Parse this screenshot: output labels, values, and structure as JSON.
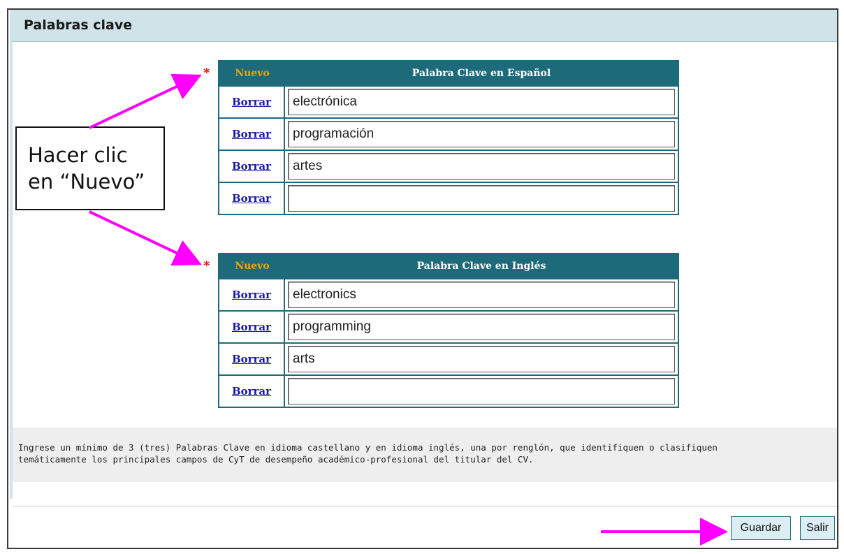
{
  "panel": {
    "title": "Palabras clave"
  },
  "tables": {
    "es": {
      "new_label": "Nuevo",
      "header": "Palabra Clave en Español",
      "rows": [
        {
          "delete_label": "Borrar",
          "value": "electrónica"
        },
        {
          "delete_label": "Borrar",
          "value": "programación"
        },
        {
          "delete_label": "Borrar",
          "value": "artes"
        },
        {
          "delete_label": "Borrar",
          "value": ""
        }
      ]
    },
    "en": {
      "new_label": "Nuevo",
      "header": "Palabra Clave en Inglés",
      "rows": [
        {
          "delete_label": "Borrar",
          "value": "electronics"
        },
        {
          "delete_label": "Borrar",
          "value": "programming"
        },
        {
          "delete_label": "Borrar",
          "value": "arts"
        },
        {
          "delete_label": "Borrar",
          "value": ""
        }
      ]
    }
  },
  "required_marker": "*",
  "callout": {
    "line1": "Hacer clic",
    "line2": "en “Nuevo”"
  },
  "help_text": {
    "line1": "Ingrese un mínimo de 3 (tres) Palabras Clave en idioma castellano y en idioma inglés, una por renglón, que identifiquen o clasifiquen",
    "line2": "temáticamente los principales campos de CyT de desempeño académico-profesional del titular del CV."
  },
  "buttons": {
    "save_label": "Guardar",
    "exit_label": "Salir"
  },
  "colors": {
    "header_bg": "#cfe3e8",
    "table_accent": "#1d6b7a",
    "nuevo_text": "#f0a500",
    "link": "#1a1aa8",
    "annotation_arrow": "#ff00ff",
    "asterisk": "#e02020"
  },
  "icons": {
    "annotation": "arrow-icon"
  }
}
